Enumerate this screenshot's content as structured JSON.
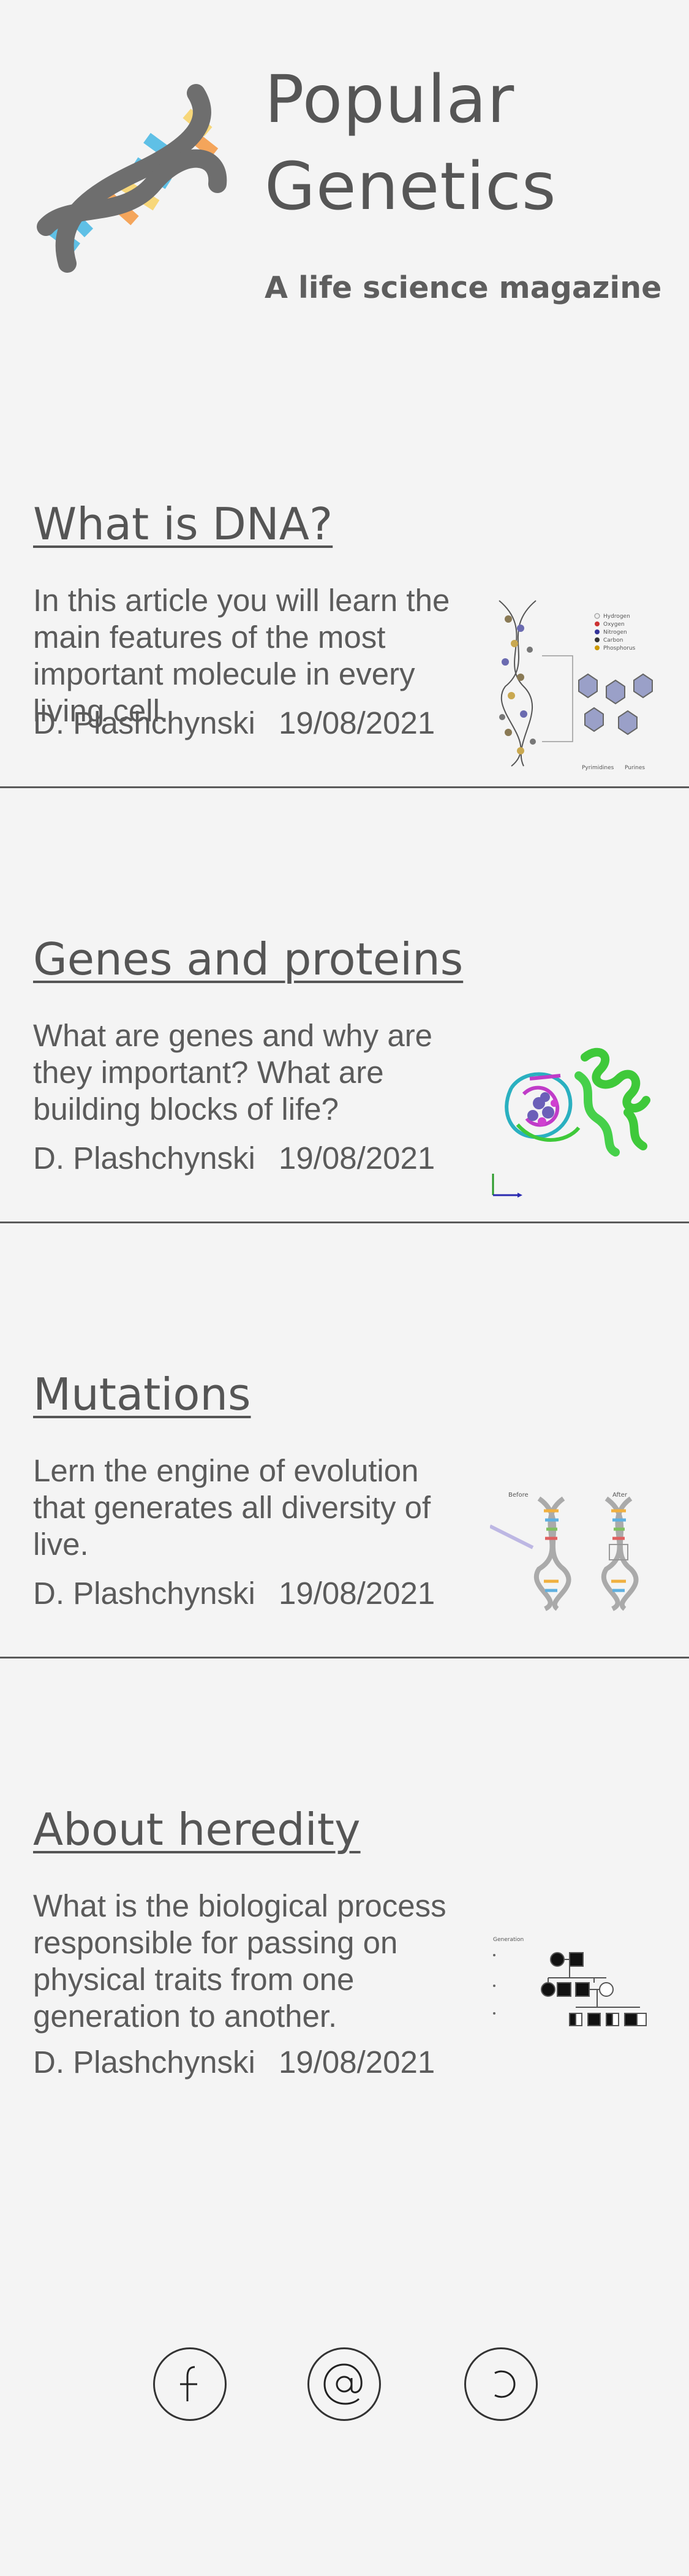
{
  "header": {
    "title": "Popular Genetics",
    "title_line1": "Popular",
    "title_line2": "Genetics",
    "subtitle": "A life science magazine",
    "logo_icon": "dna-helix-icon"
  },
  "articles": [
    {
      "title": "What is DNA?",
      "summary": "In this article you will learn the main features of the most important molecule in every living cell.",
      "author": "D. Plashchynski",
      "date": "19/08/2021",
      "thumbnail_labels": [
        "Hydrogen",
        "Oxygen",
        "Nitrogen",
        "Carbon",
        "Phosphorus",
        "Pyrimidines",
        "Purines"
      ]
    },
    {
      "title": "Genes and proteins",
      "summary": "What are genes and why are they important? What are building blocks of life?",
      "author": "D. Plashchynski",
      "date": "19/08/2021",
      "thumbnail_labels": []
    },
    {
      "title": "Mutations",
      "summary": "Lern the engine of evolution that generates all diversity of live.",
      "author": "D. Plashchynski",
      "date": "19/08/2021",
      "thumbnail_labels": [
        "Before",
        "After"
      ]
    },
    {
      "title": "About heredity",
      "summary": "What is the biological process responsible for passing on physical traits from one generation to another.",
      "author": "D. Plashchynski",
      "date": "19/08/2021",
      "thumbnail_labels": [
        "Generation"
      ]
    }
  ],
  "footer": {
    "social": [
      {
        "icon": "facebook-icon"
      },
      {
        "icon": "email-at-icon"
      },
      {
        "icon": "refresh-icon"
      }
    ]
  },
  "colors": {
    "background": "#f4f4f4",
    "text": "#555555",
    "divider": "#5a5a5a",
    "helix_gray": "#6e6e6e",
    "helix_blue": "#5fc0e6",
    "helix_orange": "#f4a55b",
    "helix_yellow": "#f7d77a"
  }
}
